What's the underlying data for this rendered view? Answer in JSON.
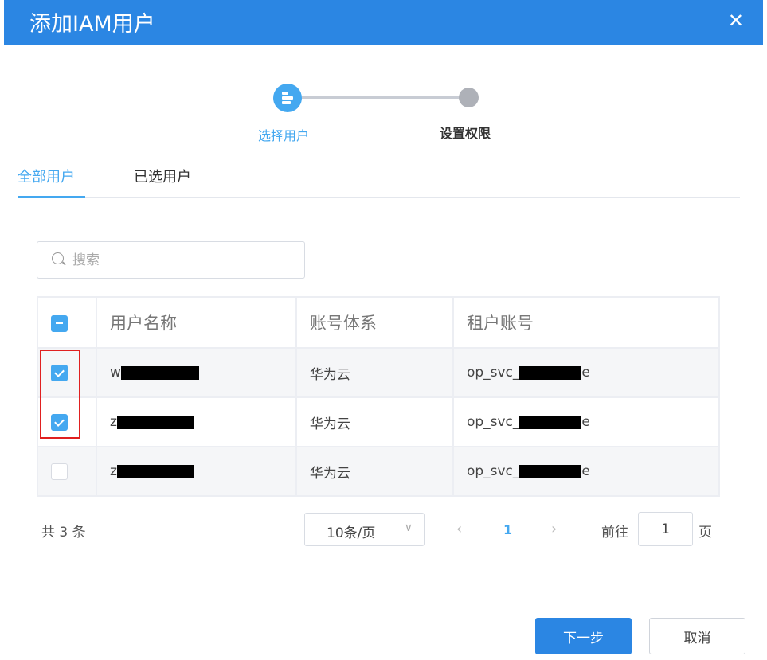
{
  "dialog": {
    "title": "添加IAM用户",
    "close": "✕"
  },
  "steps": [
    {
      "label": "选择用户",
      "state": "active"
    },
    {
      "label": "设置权限",
      "state": "pending"
    }
  ],
  "tabs": [
    {
      "label": "全部用户",
      "active": true
    },
    {
      "label": "已选用户",
      "active": false
    }
  ],
  "search": {
    "placeholder": "搜索",
    "value": ""
  },
  "table": {
    "headers": [
      "用户名称",
      "账号体系",
      "租户账号"
    ],
    "select_all_state": "indeterminate",
    "rows": [
      {
        "checked": true,
        "name": "w",
        "name_redacted": true,
        "system": "华为云",
        "account_prefix": "op_svc_",
        "account_suffix": "e"
      },
      {
        "checked": true,
        "name": "z",
        "name_redacted": true,
        "system": "华为云",
        "account_prefix": "op_svc_",
        "account_suffix": "e"
      },
      {
        "checked": false,
        "name": "z",
        "name_redacted": true,
        "system": "华为云",
        "account_prefix": "op_svc_",
        "account_suffix": "e"
      }
    ]
  },
  "pagination": {
    "total": "共 3 条",
    "page_size": "10条/页",
    "prev": "‹",
    "current": "1",
    "next": "›",
    "goto_label": "前往",
    "goto_value": "1",
    "page_label": "页"
  },
  "footer": {
    "next": "下一步",
    "cancel": "取消"
  },
  "colors": {
    "primary": "#2b86e3",
    "accent": "#44a8f0",
    "highlight": "#e02020"
  }
}
